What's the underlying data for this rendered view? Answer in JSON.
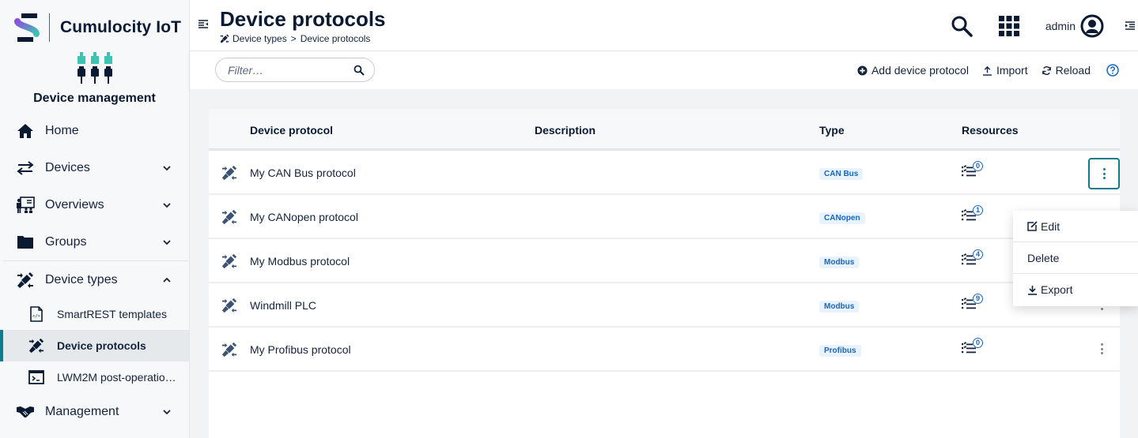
{
  "brand": {
    "name": "Cumulocity IoT",
    "logo_icon": "cumulocity-s-logo"
  },
  "app": {
    "name": "Device management",
    "icon": "plugs-icon"
  },
  "sidebar": {
    "items": [
      {
        "label": "Home",
        "icon": "home-icon",
        "expandable": false
      },
      {
        "label": "Devices",
        "icon": "exchange-arrows-icon",
        "expandable": true,
        "expanded": false
      },
      {
        "label": "Overviews",
        "icon": "presentation-icon",
        "expandable": true,
        "expanded": false
      },
      {
        "label": "Groups",
        "icon": "folder-icon",
        "expandable": true,
        "expanded": false
      },
      {
        "label": "Device types",
        "icon": "plug-connect-icon",
        "expandable": true,
        "expanded": true,
        "children": [
          {
            "label": "SmartREST templates",
            "icon": "code-file-icon",
            "active": false
          },
          {
            "label": "Device protocols",
            "icon": "plug-connect-icon",
            "active": true
          },
          {
            "label": "LWM2M post-operatio…",
            "icon": "terminal-icon",
            "active": false
          }
        ]
      },
      {
        "label": "Management",
        "icon": "handshake-icon",
        "expandable": true,
        "expanded": false
      }
    ]
  },
  "header": {
    "title": "Device protocols",
    "breadcrumb": [
      "Device types",
      "Device protocols"
    ],
    "breadcrumb_separator": ">",
    "user": "admin"
  },
  "actionbar": {
    "filter": {
      "placeholder": "Filter…",
      "value": ""
    },
    "add_label": "Add device protocol",
    "import_label": "Import",
    "reload_label": "Reload"
  },
  "table": {
    "columns": [
      "Device protocol",
      "Description",
      "Type",
      "Resources"
    ],
    "rows": [
      {
        "name": "My CAN Bus protocol",
        "description": "",
        "type": "CAN Bus",
        "resources": "0"
      },
      {
        "name": "My CANopen protocol",
        "description": "",
        "type": "CANopen",
        "resources": "1"
      },
      {
        "name": "My Modbus protocol",
        "description": "",
        "type": "Modbus",
        "resources": "4"
      },
      {
        "name": "Windmill PLC",
        "description": "",
        "type": "Modbus",
        "resources": "9"
      },
      {
        "name": "My Profibus protocol",
        "description": "",
        "type": "Profibus",
        "resources": "0"
      }
    ]
  },
  "row_menu": {
    "open_row": 0,
    "items": [
      "Edit",
      "Delete",
      "Export"
    ]
  },
  "colors": {
    "accent": "#0e7c8c",
    "primary_text": "#14233c",
    "badge_text": "#1566c0",
    "badge_bg": "#e8f3fe",
    "logo_teal": "#3fc4b4",
    "logo_purple": "#8a4fe0"
  }
}
